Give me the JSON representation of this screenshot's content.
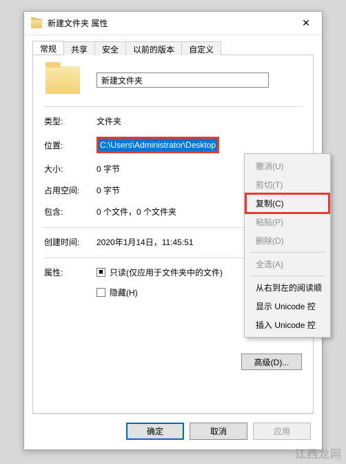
{
  "titlebar": {
    "title": "新建文件夹 属性",
    "close_icon": "✕"
  },
  "tabs": [
    {
      "label": "常规",
      "active": true
    },
    {
      "label": "共享",
      "active": false
    },
    {
      "label": "安全",
      "active": false
    },
    {
      "label": "以前的版本",
      "active": false
    },
    {
      "label": "自定义",
      "active": false
    }
  ],
  "general": {
    "name_value": "新建文件夹",
    "labels": {
      "type": "类型:",
      "location": "位置:",
      "size": "大小:",
      "size_on_disk": "占用空间:",
      "contains": "包含:",
      "created": "创建时间:",
      "attributes": "属性:"
    },
    "values": {
      "type": "文件夹",
      "location": "C:\\Users\\Administrator\\Desktop",
      "size": "0 字节",
      "size_on_disk": "0 字节",
      "contains": "0 个文件，0 个文件夹",
      "created": "2020年1月14日，11:45:51"
    },
    "readonly_label": "只读(仅应用于文件夹中的文件)",
    "readonly_checked": true,
    "hidden_label": "隐藏(H)",
    "hidden_checked": false,
    "advanced_button": "高级(D)..."
  },
  "buttons": {
    "ok": "确定",
    "cancel": "取消",
    "apply": "应用"
  },
  "context_menu": [
    {
      "label": "撤消(U)",
      "enabled": false
    },
    {
      "label": "剪切(T)",
      "enabled": false
    },
    {
      "label": "复制(C)",
      "enabled": true,
      "highlight": true
    },
    {
      "label": "粘贴(P)",
      "enabled": false
    },
    {
      "label": "删除(D)",
      "enabled": false
    },
    {
      "separator": true
    },
    {
      "label": "全选(A)",
      "enabled": false
    },
    {
      "separator": true
    },
    {
      "label": "从右到左的阅读顺",
      "enabled": true
    },
    {
      "label": "显示 Unicode 控",
      "enabled": true
    },
    {
      "label": "插入 Unicode 控",
      "enabled": true
    }
  ],
  "watermark": "江西龙网"
}
